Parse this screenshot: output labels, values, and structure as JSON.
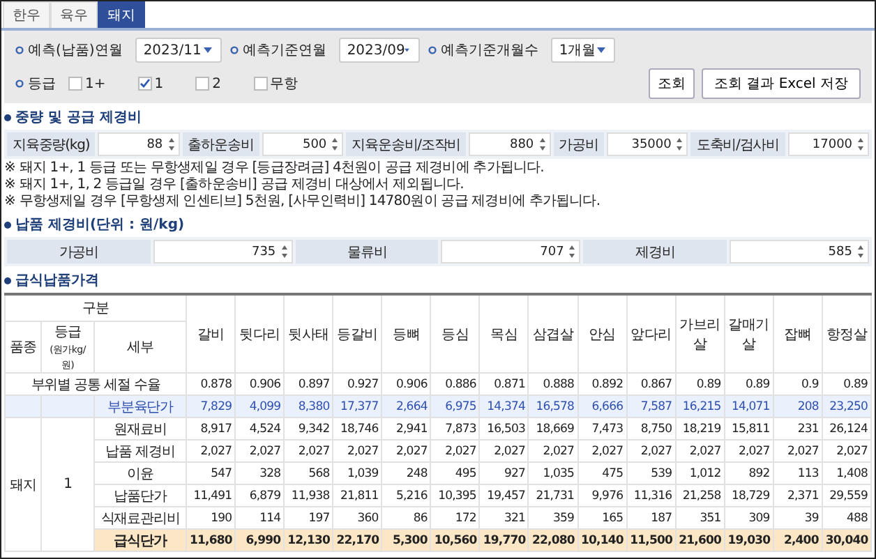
{
  "tabs": [
    {
      "label": "한우",
      "selected": false
    },
    {
      "label": "육우",
      "selected": false
    },
    {
      "label": "돼지",
      "selected": true
    }
  ],
  "filters": [
    {
      "label": "예측(납품)연월",
      "value": "2023/11"
    },
    {
      "label": "예측기준연월",
      "value": "2023/09"
    },
    {
      "label": "예측기준개월수",
      "value": "1개월"
    }
  ],
  "grade": {
    "label": "등급",
    "options": [
      {
        "label": "1+",
        "checked": false
      },
      {
        "label": "1",
        "checked": true
      },
      {
        "label": "2",
        "checked": false
      },
      {
        "label": "무항",
        "checked": false
      }
    ]
  },
  "buttons": [
    "조회",
    "조회 결과 Excel 저장"
  ],
  "supply_costs": {
    "title": "중량 및 공급 제경비",
    "fields": [
      {
        "label": "지육중량(kg)",
        "value": "88"
      },
      {
        "label": "출하운송비",
        "value": "500"
      },
      {
        "label": "지육운송비/조작비",
        "value": "880"
      },
      {
        "label": "가공비",
        "value": "35000"
      },
      {
        "label": "도축비/검사비",
        "value": "17000"
      }
    ]
  },
  "notes": [
    "※ 돼지 1+, 1 등급 또는 무항생제일 경우 [등급장려금] 4천원이 공급 제경비에 추가됩니다.",
    "※ 돼지 1+, 1, 2 등급일 경우 [출하운송비] 공급 제경비 대상에서 제외됩니다.",
    "※ 무항생제일 경우 [무항생제 인센티브] 5천원, [사무인력비] 14780원이 공급 제경비에 추가됩니다."
  ],
  "delivery_costs": {
    "title": "납품 제경비(단위 : 원/kg)",
    "fields": [
      {
        "label": "가공비",
        "value": "735"
      },
      {
        "label": "물류비",
        "value": "707"
      },
      {
        "label": "제경비",
        "value": "585"
      }
    ]
  },
  "price_table": {
    "title": "급식납품가격",
    "group_header": "구분",
    "sub_headers": [
      "품종",
      "등급",
      "세부"
    ],
    "grade_unit": "(원가kg/원)",
    "breed": "돼지",
    "grade": "1",
    "columns": [
      "갈비",
      "뒷다리",
      "뒷사태",
      "등갈비",
      "등뼈",
      "등심",
      "목심",
      "삼겹살",
      "안심",
      "앞다리",
      "가브리살",
      "갈매기살",
      "잡뼈",
      "항정살"
    ],
    "rows": [
      {
        "kind": "yield",
        "label": "부위별 공통 세절 수율",
        "values": [
          "0.878",
          "0.906",
          "0.897",
          "0.927",
          "0.906",
          "0.886",
          "0.871",
          "0.888",
          "0.892",
          "0.867",
          "0.89",
          "0.89",
          "0.9",
          "0.89"
        ]
      },
      {
        "kind": "highlight",
        "label": "부분육단가",
        "values": [
          "7,829",
          "4,099",
          "8,380",
          "17,377",
          "2,664",
          "6,975",
          "14,374",
          "16,578",
          "6,666",
          "7,587",
          "16,215",
          "14,071",
          "208",
          "23,250"
        ]
      },
      {
        "kind": "normal",
        "label": "원재료비",
        "values": [
          "8,917",
          "4,524",
          "9,342",
          "18,746",
          "2,941",
          "7,873",
          "16,503",
          "18,669",
          "7,473",
          "8,750",
          "18,219",
          "15,811",
          "231",
          "26,124"
        ]
      },
      {
        "kind": "normal",
        "label": "납품 제경비",
        "values": [
          "2,027",
          "2,027",
          "2,027",
          "2,027",
          "2,027",
          "2,027",
          "2,027",
          "2,027",
          "2,027",
          "2,027",
          "2,027",
          "2,027",
          "2,027",
          "2,027"
        ]
      },
      {
        "kind": "normal",
        "label": "이윤",
        "values": [
          "547",
          "328",
          "568",
          "1,039",
          "248",
          "495",
          "927",
          "1,035",
          "475",
          "539",
          "1,012",
          "892",
          "113",
          "1,408"
        ]
      },
      {
        "kind": "normal",
        "label": "납품단가",
        "values": [
          "11,491",
          "6,879",
          "11,938",
          "21,811",
          "5,216",
          "10,395",
          "19,457",
          "21,731",
          "9,976",
          "11,316",
          "21,258",
          "18,729",
          "2,371",
          "29,559"
        ]
      },
      {
        "kind": "normal",
        "label": "식재료관리비",
        "values": [
          "190",
          "114",
          "197",
          "360",
          "86",
          "172",
          "321",
          "359",
          "165",
          "187",
          "351",
          "309",
          "39",
          "488"
        ]
      },
      {
        "kind": "total",
        "label": "급식단가",
        "values": [
          "11,680",
          "6,990",
          "12,130",
          "22,170",
          "5,300",
          "10,560",
          "19,770",
          "22,080",
          "10,140",
          "11,500",
          "21,600",
          "19,030",
          "2,400",
          "30,040"
        ]
      }
    ]
  }
}
